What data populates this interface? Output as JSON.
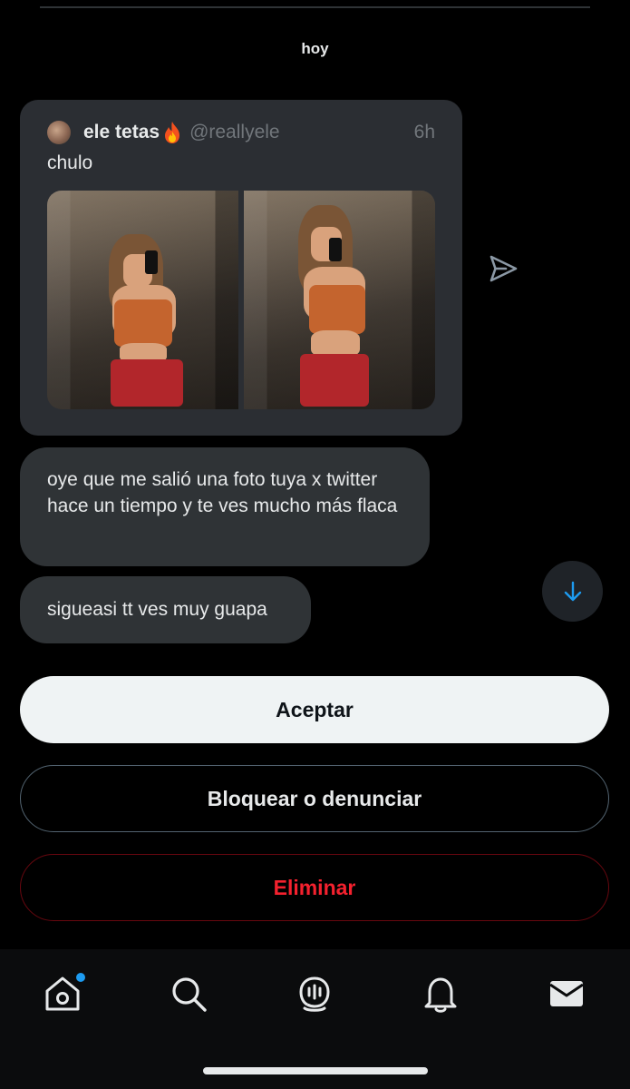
{
  "conversation": {
    "date_separator": "hoy"
  },
  "quoted_tweet": {
    "author": "ele tetas",
    "emoji": "🔥",
    "handle": "@reallyele",
    "time": "6h",
    "text": "chulo",
    "media_count": 2
  },
  "messages": [
    {
      "text": "oye que me salió una foto tuya x twitter hace un tiempo y te ves mucho más flaca"
    },
    {
      "text": "sigueasi tt ves muy guapa"
    }
  ],
  "actions": {
    "accept_label": "Aceptar",
    "block_label": "Bloquear o denunciar",
    "delete_label": "Eliminar"
  },
  "nav": {
    "items": [
      {
        "icon": "home-icon",
        "has_notification_dot": true
      },
      {
        "icon": "search-icon",
        "has_notification_dot": false
      },
      {
        "icon": "spaces-icon",
        "has_notification_dot": false
      },
      {
        "icon": "bell-icon",
        "has_notification_dot": false
      },
      {
        "icon": "mail-icon",
        "has_notification_dot": false,
        "active": true
      }
    ]
  },
  "colors": {
    "background": "#000000",
    "bubble": "#2f3336",
    "accent": "#1d9bf0",
    "danger": "#f4212e"
  }
}
